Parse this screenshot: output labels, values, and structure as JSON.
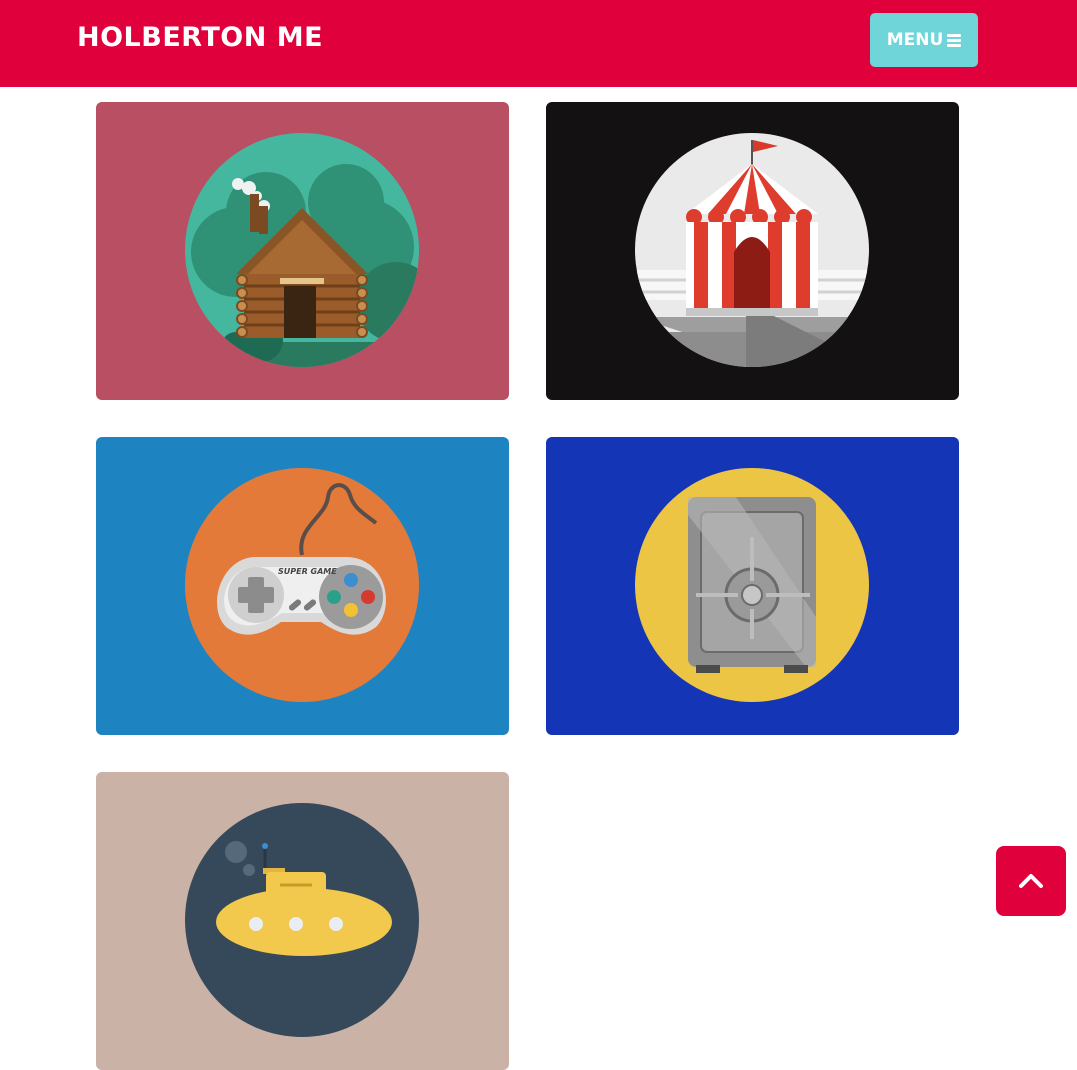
{
  "header": {
    "brand": "HOLBERTON ME",
    "menu_label": "MENU",
    "brand_color": "#e0003c",
    "menu_color": "#6fd5d9"
  },
  "portfolio": {
    "items": [
      {
        "icon": "log-cabin-icon",
        "background": "#b94f62"
      },
      {
        "icon": "circus-tent-icon",
        "background": "#141112"
      },
      {
        "icon": "game-controller-icon",
        "background": "#1e84c1"
      },
      {
        "icon": "safe-icon",
        "background": "#1436b6"
      },
      {
        "icon": "submarine-icon",
        "background": "#cbb2a6"
      }
    ],
    "controller_text": "SUPER GAME"
  },
  "back_to_top": {
    "icon": "chevron-up-icon"
  }
}
